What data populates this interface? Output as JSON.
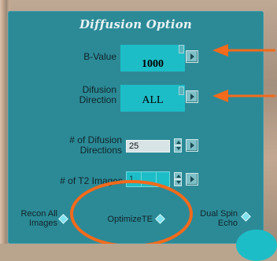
{
  "dialog": {
    "title": "Diffusion Option"
  },
  "fields": {
    "b_value": {
      "label": "B-Value",
      "value": "1000"
    },
    "diffusion_direction": {
      "label_line1": "Difusion",
      "label_line2": "Direction",
      "value": "ALL"
    },
    "num_directions": {
      "label_line1": "# of Difusion",
      "label_line2": "Directions",
      "value": "25"
    },
    "num_t2": {
      "label": "# of T2 Images",
      "value": "1"
    }
  },
  "options": {
    "recon_all": {
      "label_line1": "Recon All",
      "label_line2": "Images"
    },
    "optimize_te": {
      "label": "OptimizeTE"
    },
    "dual_spin_echo": {
      "label_line1": "Dual Spin",
      "label_line2": "Echo"
    }
  },
  "annotations": {
    "accent_color": "#f26a1b",
    "panel_color": "#2c8a97",
    "field_color": "#1dbdc7"
  },
  "icons": [
    "arrow-right-icon",
    "spin-up-icon",
    "spin-down-icon",
    "diamond-radio-icon"
  ]
}
